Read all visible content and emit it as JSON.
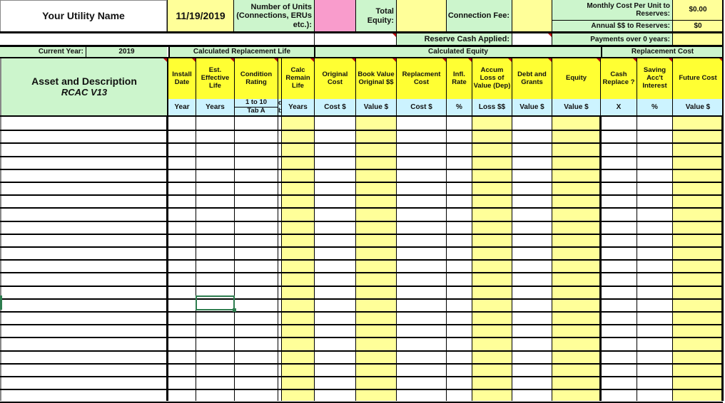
{
  "header": {
    "utility_name": "Your Utility Name",
    "date": "11/19/2019",
    "units_label": "Number of Units (Connections, ERUs etc.):",
    "units_value": "",
    "total_equity_label": "Total Equity:",
    "total_equity_value": "",
    "connection_fee_label": "Connection Fee:",
    "connection_fee_value": "",
    "monthly_cost_label": "Monthly Cost Per Unit to Reserves:",
    "monthly_cost_value": "$0.00",
    "annual_reserves_label": "Annual  $$ to Reserves:",
    "annual_reserves_value": "$0",
    "reserve_cash_label": "Reserve Cash Applied:",
    "reserve_cash_value": "",
    "payments_label": "Payments over 0 years:",
    "payments_value": "",
    "current_year_label": "Current Year:",
    "current_year_value": "2019"
  },
  "groups": {
    "replacement_life": "Calculated Replacement Life",
    "equity": "Calculated Equity",
    "replacement_cost": "Replacement Cost"
  },
  "asset": {
    "title": "Asset and Description",
    "subtitle": "RCAC V13"
  },
  "columns": [
    {
      "key": "install_date",
      "label": "Install Date",
      "unit": "Year"
    },
    {
      "key": "effective_life",
      "label": "Est. Effective Life",
      "unit": "Years"
    },
    {
      "key": "condition_rating",
      "label": "Condition Rating",
      "unit": "1 to 10",
      "unit2": "Tab A"
    },
    {
      "key": "remain_life",
      "label": "Calc Remain Life",
      "unit": "Years"
    },
    {
      "key": "original_cost",
      "label": "Original Cost",
      "unit": "Cost $"
    },
    {
      "key": "book_value",
      "label": "Book Value Original $$",
      "unit": "Value $"
    },
    {
      "key": "replacement_cost",
      "label": "Replacment Cost",
      "unit": "Cost $"
    },
    {
      "key": "infl_rate",
      "label": "Infl. Rate",
      "unit": "%"
    },
    {
      "key": "accum_loss",
      "label": "Accum Loss of Value (Dep)",
      "unit": "Loss $$"
    },
    {
      "key": "debt_grants",
      "label": "Debt and Grants",
      "unit": "Value $"
    },
    {
      "key": "equity",
      "label": "Equity",
      "unit": "Value $"
    },
    {
      "key": "cash_replace",
      "label": "Cash Replace ?",
      "unit": "X"
    },
    {
      "key": "saving_interest",
      "label": "Saving Acc't Interest",
      "unit": "%"
    },
    {
      "key": "future_cost",
      "label": "Future Cost",
      "unit": "Value $"
    }
  ],
  "narrow_col": {
    "top": "d",
    "bottom": "b"
  },
  "data_rows": 22
}
